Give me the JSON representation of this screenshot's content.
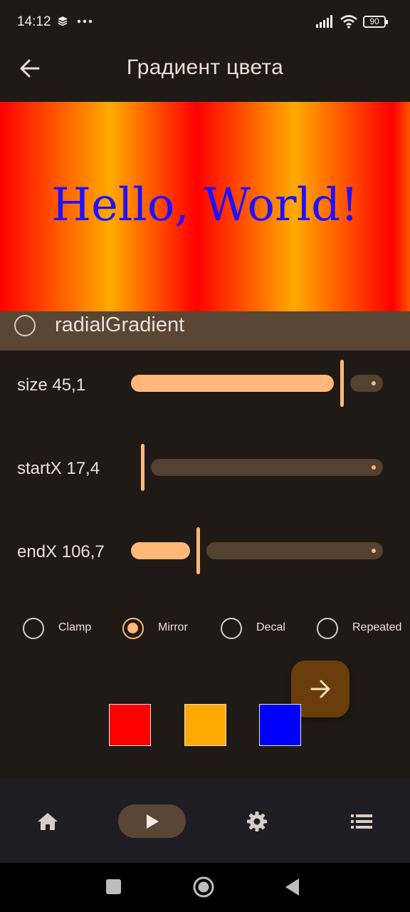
{
  "status_bar": {
    "time": "14:12",
    "battery": "90",
    "icons": [
      "layers-icon",
      "more-dots-icon",
      "signal-icon",
      "wifi-icon",
      "battery-icon"
    ]
  },
  "app_bar": {
    "title": "Градиент цвета",
    "back_icon": "arrow-left-icon"
  },
  "preview": {
    "text": "Hello, World!",
    "text_color": "#1f10ff",
    "gradient_colors": [
      "#ff0000",
      "#ffaa00"
    ]
  },
  "gradient_option": {
    "label": "radialGradient",
    "selected": false
  },
  "sliders": [
    {
      "label": "size 45,1",
      "value": 45.1,
      "fraction": 0.92
    },
    {
      "label": "startX 17,4",
      "value": 17.4,
      "fraction": 0.0
    },
    {
      "label": "endX 106,7",
      "value": 106.7,
      "fraction": 0.27
    }
  ],
  "tile_modes": {
    "options": [
      "Clamp",
      "Mirror",
      "Decal",
      "Repeated"
    ],
    "selected": "Mirror"
  },
  "fab": {
    "icon": "arrow-right-icon"
  },
  "color_swatches": [
    "#ff0000",
    "#ffaa00",
    "#0000ff"
  ],
  "bottom_nav": {
    "items": [
      "home-icon",
      "play-icon",
      "settings-icon",
      "list-icon"
    ],
    "selected": "play-icon"
  },
  "accent_color": "#ffb877"
}
